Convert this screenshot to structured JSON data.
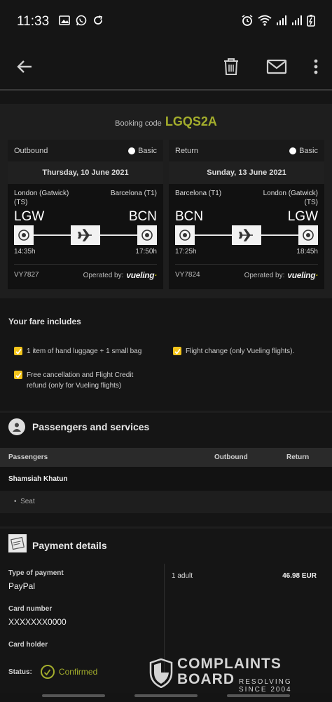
{
  "status_bar": {
    "time": "11:33",
    "left_icons": [
      "image-icon",
      "whatsapp-icon",
      "sync-icon"
    ],
    "right_icons": [
      "alarm-icon",
      "wifi-icon",
      "signal-icon",
      "signal-icon",
      "battery-icon"
    ]
  },
  "app_bar": {
    "back_icon": "arrow-left-icon",
    "actions": [
      "trash-icon",
      "mail-icon",
      "more-vertical-icon"
    ]
  },
  "booking": {
    "label": "Booking code",
    "code": "LGQS2A"
  },
  "flights": [
    {
      "direction": "Outbound",
      "fare": "Basic",
      "date": "Thursday, 10 June 2021",
      "from_city": "London (Gatwick) (TS)",
      "to_city": "Barcelona (T1)",
      "from_code": "LGW",
      "to_code": "BCN",
      "depart": "14:35h",
      "arrive": "17:50h",
      "flight_no": "VY7827",
      "operated_by": "Operated by:",
      "airline": "vueling"
    },
    {
      "direction": "Return",
      "fare": "Basic",
      "date": "Sunday, 13 June 2021",
      "from_city": "Barcelona (T1)",
      "to_city": "London (Gatwick) (TS)",
      "from_code": "BCN",
      "to_code": "LGW",
      "depart": "17:25h",
      "arrive": "18:45h",
      "flight_no": "VY7824",
      "operated_by": "Operated by:",
      "airline": "vueling"
    }
  ],
  "fare": {
    "title": "Your fare includes",
    "items": [
      "1 item of hand luggage + 1 small bag",
      "Flight change (only Vueling flights).",
      "Free cancellation and Flight Credit refund (only for Vueling flights)"
    ]
  },
  "passengers": {
    "title": "Passengers and services",
    "col_passengers": "Passengers",
    "col_outbound": "Outbound",
    "col_return": "Return",
    "name": "Shamsiah Khatun",
    "service": "Seat"
  },
  "payment": {
    "title": "Payment details",
    "type_label": "Type of payment",
    "type_value": "PayPal",
    "card_label": "Card number",
    "card_value": "XXXXXXX0000",
    "holder_label": "Card holder",
    "status_label": "Status:",
    "status_value": "Confirmed",
    "adult_label": "1 adult",
    "price": "46.98 EUR"
  },
  "watermark": {
    "line1": "COMPLAINTS",
    "line2": "BOARD",
    "tag1": "RESOLVING",
    "tag2": "SINCE 2004"
  },
  "colors": {
    "accent": "#a3ad2c",
    "background": "#151515",
    "panel": "#1e1e1e",
    "check": "#f3c41b"
  }
}
